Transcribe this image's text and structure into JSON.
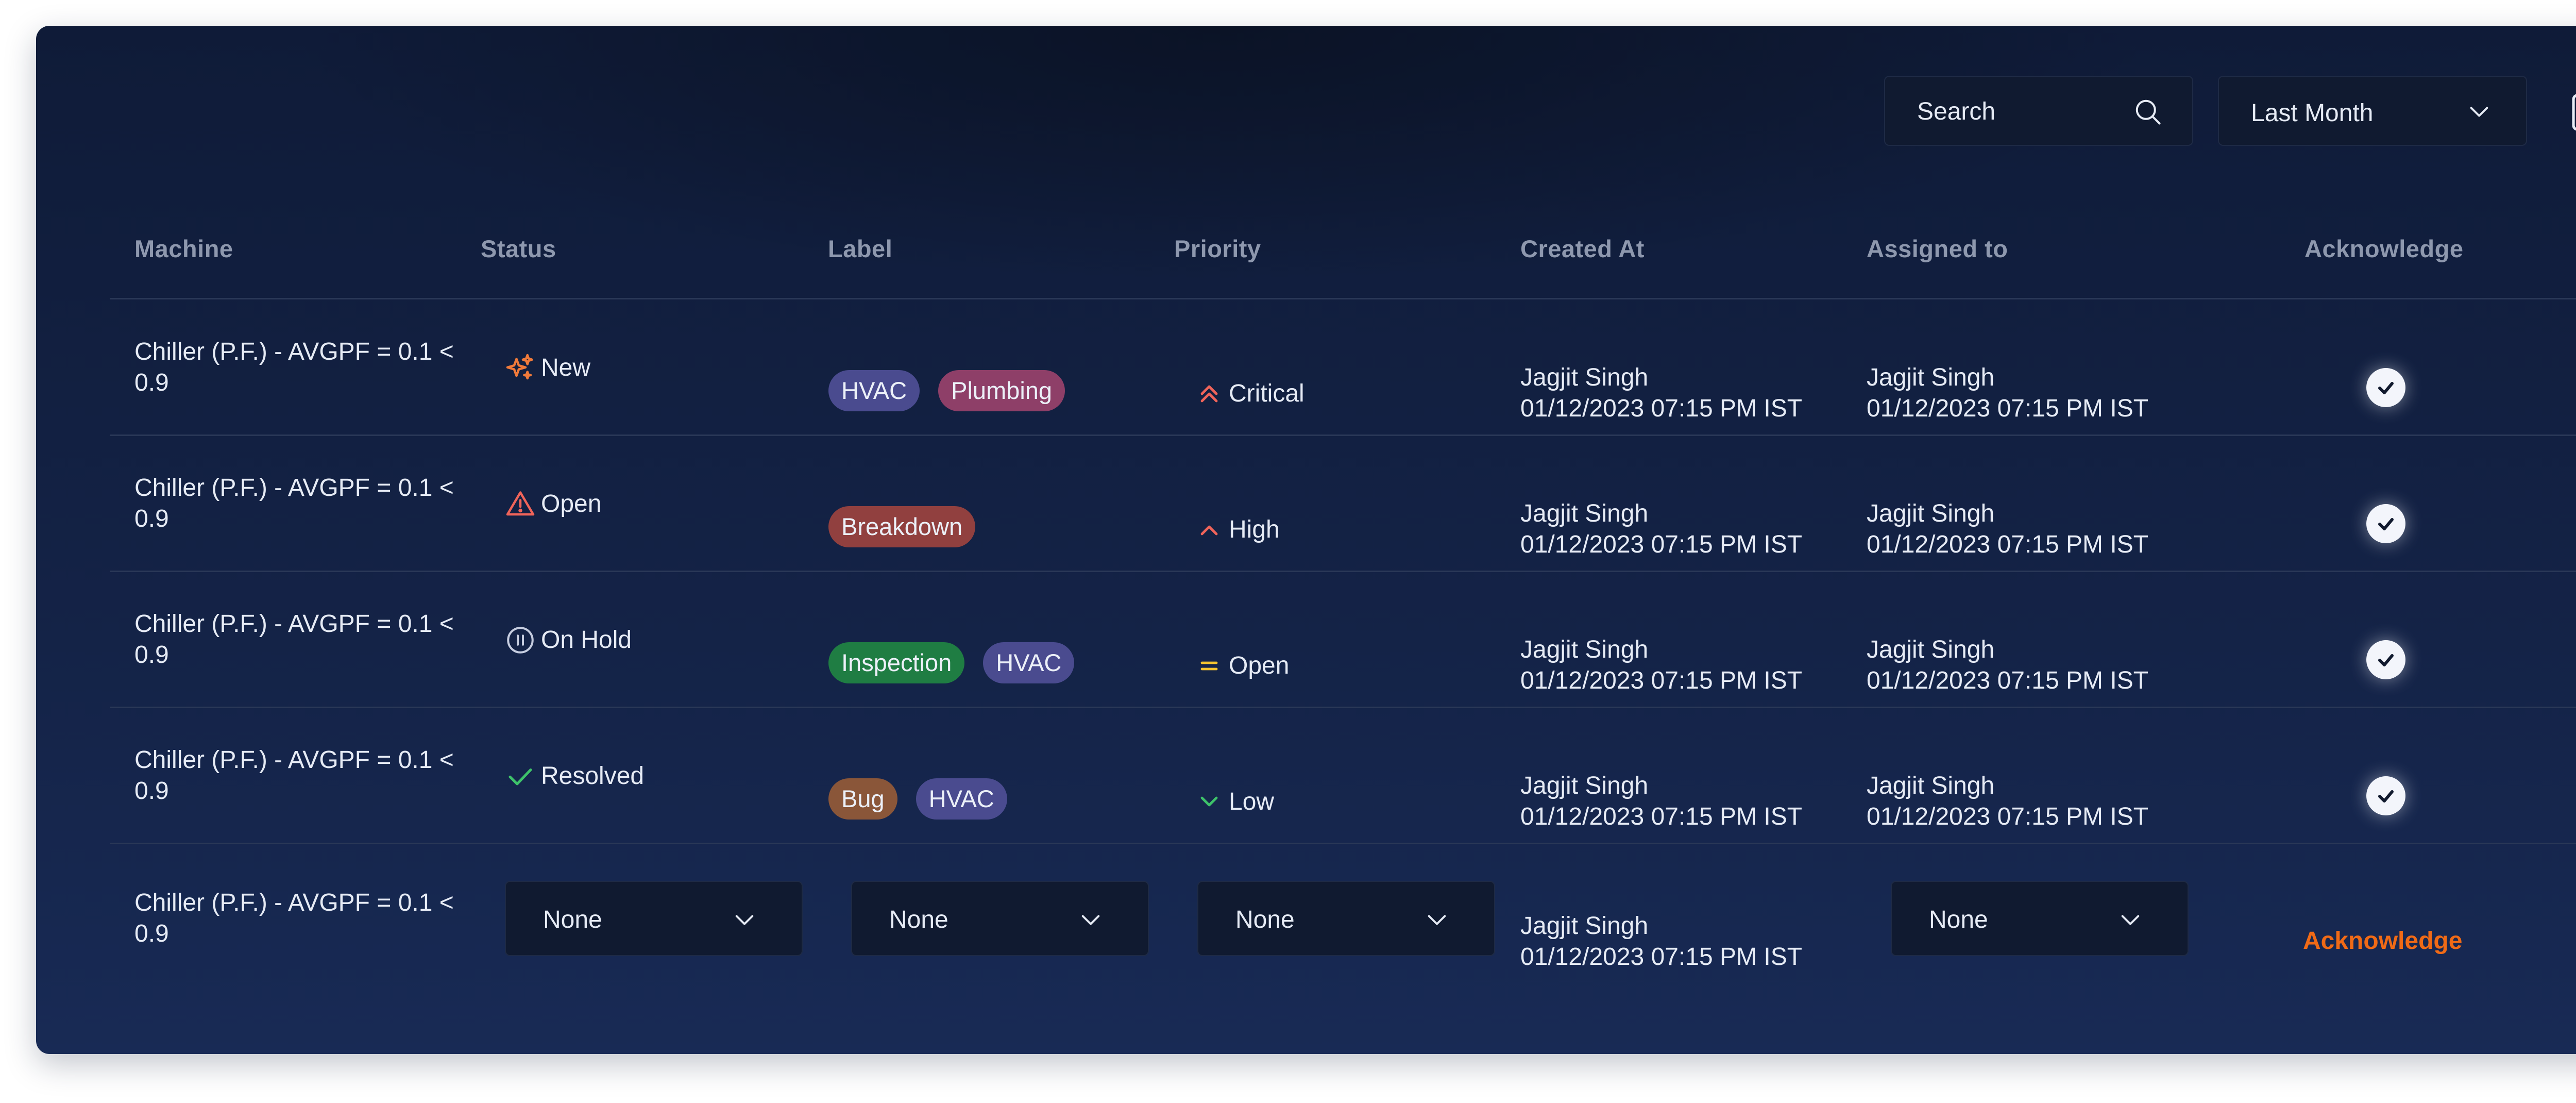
{
  "toolbar": {
    "search_placeholder": "Search",
    "range_value": "Last Month",
    "export_icon": "file-download-icon"
  },
  "columns": {
    "machine": "Machine",
    "status": "Status",
    "label": "Label",
    "priority": "Priority",
    "created_at": "Created At",
    "assigned_to": "Assigned to",
    "acknowledge": "Acknowledge"
  },
  "rows": [
    {
      "machine_line1": "Chiller (P.F.) - AVGPF = 0.1 <",
      "machine_line2": "0.9",
      "status": "New",
      "status_icon": "sparkle-icon",
      "labels": [
        "HVAC",
        "Plumbing"
      ],
      "priority": "Critical",
      "priority_icon": "double-chevron-up-icon",
      "created_name": "Jagjit Singh",
      "created_time": "01/12/2023 07:15 PM IST",
      "assigned_name": "Jagjit Singh",
      "assigned_time": "01/12/2023 07:15 PM IST",
      "acknowledged": true
    },
    {
      "machine_line1": "Chiller (P.F.) - AVGPF = 0.1 <",
      "machine_line2": "0.9",
      "status": "Open",
      "status_icon": "warning-triangle-icon",
      "labels": [
        "Breakdown"
      ],
      "priority": "High",
      "priority_icon": "chevron-up-icon",
      "created_name": "Jagjit Singh",
      "created_time": "01/12/2023 07:15 PM IST",
      "assigned_name": "Jagjit Singh",
      "assigned_time": "01/12/2023 07:15 PM IST",
      "acknowledged": true
    },
    {
      "machine_line1": "Chiller (P.F.) - AVGPF = 0.1 <",
      "machine_line2": "0.9",
      "status": "On Hold",
      "status_icon": "pause-circle-icon",
      "labels": [
        "Inspection",
        "HVAC"
      ],
      "priority": "Open",
      "priority_icon": "equals-icon",
      "created_name": "Jagjit Singh",
      "created_time": "01/12/2023 07:15 PM IST",
      "assigned_name": "Jagjit Singh",
      "assigned_time": "01/12/2023 07:15 PM IST",
      "acknowledged": true
    },
    {
      "machine_line1": "Chiller (P.F.) - AVGPF = 0.1 <",
      "machine_line2": "0.9",
      "status": "Resolved",
      "status_icon": "check-icon",
      "labels": [
        "Bug",
        "HVAC"
      ],
      "priority": "Low",
      "priority_icon": "chevron-down-icon",
      "created_name": "Jagjit Singh",
      "created_time": "01/12/2023 07:15 PM IST",
      "assigned_name": "Jagjit Singh",
      "assigned_time": "01/12/2023 07:15 PM IST",
      "acknowledged": true
    },
    {
      "machine_line1": "Chiller (P.F.) - AVGPF = 0.1 <",
      "machine_line2": "0.9",
      "status_select": "None",
      "label_select": "None",
      "priority_select": "None",
      "created_name": "Jagjit Singh",
      "created_time": "01/12/2023 07:15 PM IST",
      "assigned_select": "None",
      "acknowledge_action": "Acknowledge"
    }
  ],
  "colors": {
    "tag_hvac": "#4a4b8f",
    "tag_plumbing": "#8e3f68",
    "tag_breakdown": "#91403f",
    "tag_inspection": "#1f7d43",
    "tag_bug": "#8a5639",
    "accent_orange": "#f06a16"
  }
}
